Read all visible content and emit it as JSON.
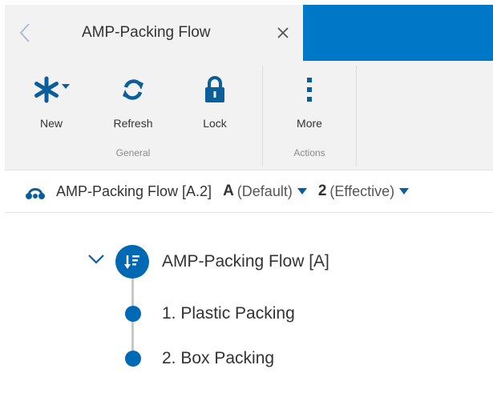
{
  "tab": {
    "title": "AMP-Packing Flow",
    "back_icon": "chevron-left-icon",
    "close_icon": "close-icon"
  },
  "ribbon": {
    "groups": [
      {
        "label": "General",
        "buttons": [
          {
            "label": "New",
            "icon": "asterisk-icon",
            "has_dropdown": true
          },
          {
            "label": "Refresh",
            "icon": "refresh-icon"
          },
          {
            "label": "Lock",
            "icon": "lock-icon"
          }
        ]
      },
      {
        "label": "Actions",
        "buttons": [
          {
            "label": "More",
            "icon": "vertical-ellipsis-icon"
          }
        ]
      }
    ]
  },
  "context": {
    "icon": "flow-icon",
    "name": "AMP-Packing Flow [A.2]",
    "revision": {
      "letter": "A",
      "note": "(Default)"
    },
    "effectivity": {
      "number": "2",
      "note": "(Effective)"
    }
  },
  "tree": {
    "root": {
      "label": "AMP-Packing Flow [A]",
      "icon": "sorted-list-icon",
      "expanded": true
    },
    "children": [
      {
        "label": "1. Plastic Packing"
      },
      {
        "label": "2. Box Packing"
      }
    ]
  },
  "colors": {
    "accent": "#0078c8",
    "node_blue": "#0069b4",
    "ribbon_bg": "#f2f2f2",
    "tab_back_icon": "#a9bfd2",
    "tree_line": "#c8c8c8"
  }
}
